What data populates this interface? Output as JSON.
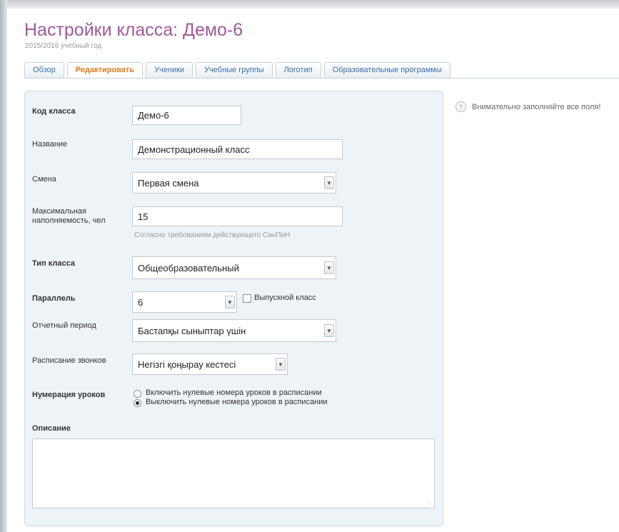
{
  "header": {
    "title": "Настройки класса: Демо-6",
    "subtitle": "2015/2016 учебный год"
  },
  "tabs": [
    {
      "label": "Обзор",
      "active": false
    },
    {
      "label": "Редактировать",
      "active": true
    },
    {
      "label": "Ученики",
      "active": false
    },
    {
      "label": "Учебные группы",
      "active": false
    },
    {
      "label": "Логотип",
      "active": false
    },
    {
      "label": "Образовательные программы",
      "active": false
    }
  ],
  "notice": {
    "icon": "help-icon",
    "text": "Внимательно заполняйте все поля!"
  },
  "form": {
    "class_code": {
      "label": "Код класса",
      "value": "Демо-6"
    },
    "name": {
      "label": "Название",
      "value": "Демонстрационный класс"
    },
    "shift": {
      "label": "Смена",
      "value": "Первая смена"
    },
    "capacity": {
      "label_line1": "Максимальная",
      "label_line2": "наполняемость, чел",
      "value": "15",
      "hint": "Согласно требованиям действующего СанПиН"
    },
    "class_type": {
      "label": "Тип класса",
      "value": "Общеобразовательный"
    },
    "parallel": {
      "label": "Параллель",
      "value": "6"
    },
    "graduation": {
      "label": "Выпускной класс",
      "checked": false
    },
    "report_period": {
      "label": "Отчетный период",
      "value": "Бастапқы сыныптар үшін"
    },
    "bell_schedule": {
      "label": "Расписание звонков",
      "value": "Негізгі қоңырау кестесі"
    },
    "lesson_numbering": {
      "label": "Нумерация уроков",
      "options": [
        {
          "label": "Включить нулевые номера уроков в расписании",
          "selected": false
        },
        {
          "label": "Выключить нулевые номера уроков в расписании",
          "selected": true
        }
      ]
    },
    "description": {
      "label": "Описание",
      "value": ""
    }
  },
  "colors": {
    "title": "#a05a9c",
    "active_tab": "#e07a1f",
    "tab_text": "#3b6ea8",
    "panel_bg": "#eef3f8"
  }
}
